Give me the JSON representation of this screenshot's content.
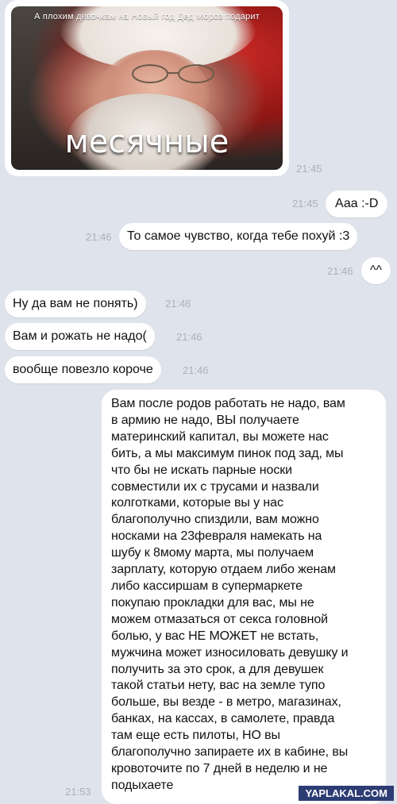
{
  "image_message": {
    "caption_top": "А плохим девочкам на Новый год Дед Мороз подарит",
    "caption_big": "месячные",
    "time": "21:45"
  },
  "messages": [
    {
      "side": "right",
      "text": "Ааа :-D",
      "time": "21:45"
    },
    {
      "side": "right",
      "text": "То самое чувство, когда тебе похуй :3",
      "time": "21:46"
    },
    {
      "side": "right",
      "text": "^^",
      "time": "21:46"
    },
    {
      "side": "left",
      "text": "Ну да вам не понять)",
      "time": "21:46"
    },
    {
      "side": "left",
      "text": "Вам и рожать не надо(",
      "time": "21:46"
    },
    {
      "side": "left",
      "text": "вообще повезло короче",
      "time": "21:46"
    }
  ],
  "long_message": {
    "time": "21:53",
    "lines": [
      "Вам после родов работать не надо, вам",
      "в армию не надо, ВЫ получаете",
      "материнский капитал, вы можете нас",
      "бить, а мы максимум пинок под зад, мы",
      "что бы не искать парные носки",
      "совместили их с трусами и назвали",
      "колготками, которые вы у нас",
      "благополучно спиздили, вам можно",
      "носками на 23февраля намекать на",
      "шубу к 8мому марта, мы получаем",
      "зарплату, которую отдаем либо женам",
      "либо кассиршам в супермаркете",
      "покупаю прокладки для вас, мы не",
      "можем отмазаться от секса головной",
      "болью, у вас НЕ МОЖЕТ не встать,",
      "мужчина может износиловать девушку и",
      "получить за это срок, а для девушек",
      "такой статьи нету, вас на земле тупо",
      "больше, вы везде - в метро, магазинах,",
      "банках, на кассах, в самолете, правда",
      "там еще есть пилоты, НО вы",
      "благополучно запираете их в кабине, вы",
      "кровоточите по 7 дней в неделю и не",
      "подыхаете"
    ]
  },
  "watermark": "YAPLAKAL.COM",
  "colors": {
    "background": "#dfe3ec",
    "bubble": "#ffffff",
    "time_text": "#aab0bd",
    "watermark_bg": "#2d3c73"
  }
}
